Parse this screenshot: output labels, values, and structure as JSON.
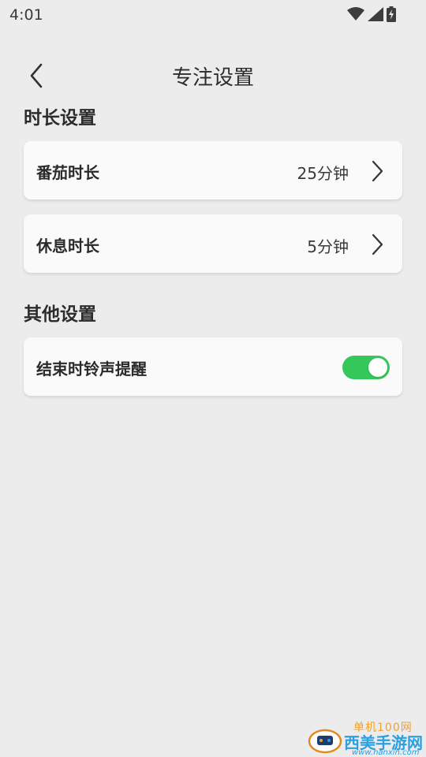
{
  "status_bar": {
    "time": "4:01",
    "icons": [
      "wifi-icon",
      "signal-icon",
      "battery-charging-icon"
    ]
  },
  "header": {
    "title": "专注设置",
    "back_icon": "chevron-left-icon"
  },
  "sections": [
    {
      "title": "时长设置",
      "items": [
        {
          "label": "番茄时长",
          "value": "25分钟",
          "control": "chevron"
        },
        {
          "label": "休息时长",
          "value": "5分钟",
          "control": "chevron"
        }
      ]
    },
    {
      "title": "其他设置",
      "items": [
        {
          "label": "结束时铃声提醒",
          "control": "toggle",
          "enabled": true
        }
      ]
    }
  ],
  "colors": {
    "background": "#ececec",
    "card": "#fafafa",
    "toggle_on": "#34c759",
    "text": "#2a2a2a"
  },
  "watermark": {
    "top_text": "单机100网",
    "main_text": "西美手游网",
    "url": "www.hanxin.com"
  }
}
